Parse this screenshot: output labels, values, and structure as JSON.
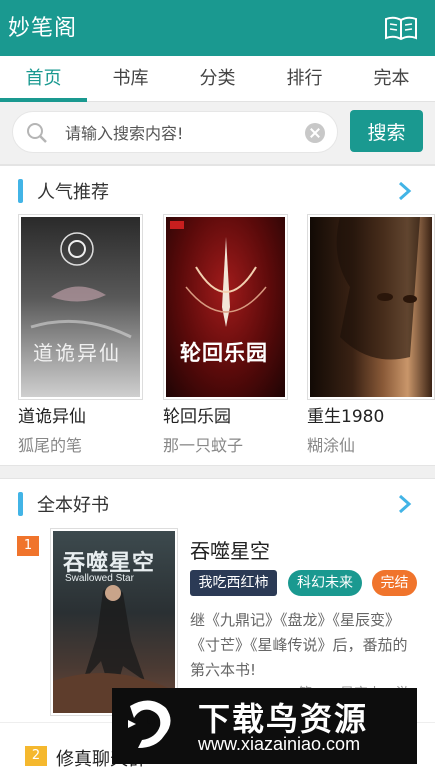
{
  "app": {
    "title": "妙笔阁",
    "icon": "open-book-icon"
  },
  "tabs": [
    {
      "label": "首页",
      "active": true
    },
    {
      "label": "书库",
      "active": false
    },
    {
      "label": "分类",
      "active": false
    },
    {
      "label": "排行",
      "active": false
    },
    {
      "label": "完本",
      "active": false
    }
  ],
  "search": {
    "placeholder": "请输入搜索内容!",
    "value": "",
    "button_label": "搜索"
  },
  "popular": {
    "title": "人气推荐",
    "books": [
      {
        "name": "道诡异仙",
        "author": "狐尾的笔",
        "cover_text": "道诡异仙"
      },
      {
        "name": "轮回乐园",
        "author": "那一只蚊子",
        "cover_text": "轮回乐园"
      },
      {
        "name": "重生1980",
        "author": "糊涂仙",
        "cover_text": ""
      }
    ]
  },
  "complete": {
    "title": "全本好书",
    "featured": {
      "rank": "1",
      "name": "吞噬星空",
      "cover_text": "吞噬星空",
      "cover_subtext": "Swallowed Star",
      "tags": [
        "我吃西红柿",
        "科幻未来",
        "完结"
      ],
      "description": "继《九鼎记》《盘龙》《星辰变》《寸芒》《星峰传说》后，番茄的第六本书!",
      "more": "……第一…星空上…游"
    },
    "second": {
      "rank": "2",
      "name": "修真聊天群"
    }
  },
  "watermark": {
    "text": "下载鸟资源",
    "url": "www.xiazainiao.com"
  },
  "colors": {
    "primary": "#1a9990",
    "accent_bar": "#42b4e6",
    "rank1": "#f0742c",
    "rank2": "#f5b82e",
    "tag_author": "#2b3a55",
    "tag_genre": "#1a9990",
    "tag_status": "#f0742c"
  }
}
